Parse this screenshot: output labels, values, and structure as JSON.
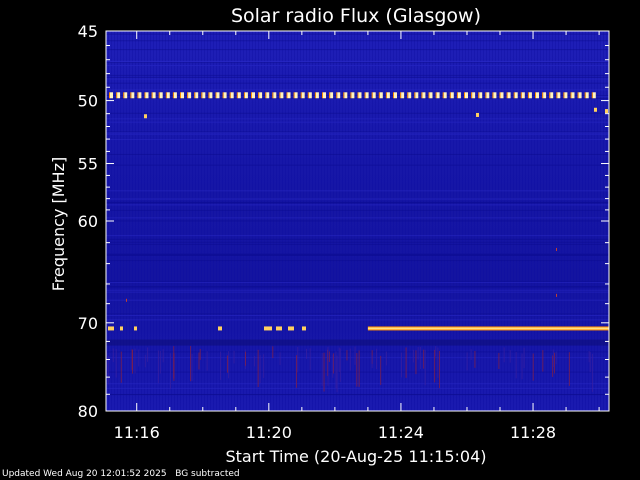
{
  "chart_data": {
    "type": "heatmap",
    "title": "Solar radio Flux (Glasgow)",
    "xlabel": "Start Time (20-Aug-25 11:15:04)",
    "ylabel": "Frequency [MHz]",
    "x_range_minutes": [
      11.2,
      15.2
    ],
    "y_range_mhz": [
      45,
      80
    ],
    "y_scale": "log",
    "x_ticks": [
      {
        "label": "11:16",
        "value": 11.27
      },
      {
        "label": "11:20",
        "value": 11.33
      },
      {
        "label": "11:24",
        "value": 11.4
      },
      {
        "label": "11:28",
        "value": 11.47
      }
    ],
    "y_ticks": [
      45,
      50,
      55,
      60,
      70,
      80
    ],
    "colormap": [
      "#000080",
      "#1a1ab0",
      "#c03020",
      "#ff8000",
      "#ffff80"
    ],
    "features": [
      {
        "name": "dotted line",
        "frequency_mhz": 49.6,
        "start": "11:15",
        "end": "11:30"
      },
      {
        "name": "emission band",
        "frequency_mhz": 70.6,
        "start": "11:23",
        "end": "11:30"
      }
    ]
  },
  "footer": {
    "updated": "Updated Wed Aug 20 12:01:52 2025",
    "note": "BG subtracted"
  }
}
